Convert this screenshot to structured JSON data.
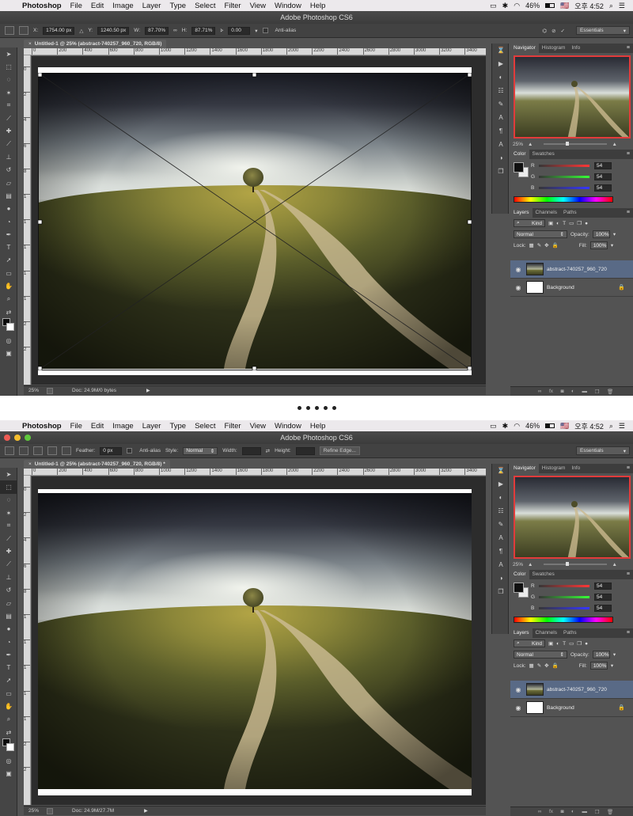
{
  "menubar": {
    "app_name": "Photoshop",
    "menus": [
      "File",
      "Edit",
      "Image",
      "Layer",
      "Type",
      "Select",
      "Filter",
      "View",
      "Window",
      "Help"
    ],
    "battery": "46%",
    "flag": "🇺🇸",
    "clock": "오후 4:52"
  },
  "window": {
    "title": "Adobe Photoshop CS6"
  },
  "document": {
    "tab_title_1": "Untitled-1 @ 25% (abstract-740257_960_720, RGB/8)",
    "tab_title_2": "Untitled-1 @ 25% (abstract-740257_960_720, RGB/8) *",
    "zoom": "25%",
    "doc_info_1": "Doc: 24.9M/0 bytes",
    "doc_info_2": "Doc: 24.9M/27.7M"
  },
  "ruler": {
    "h_ticks": [
      "0",
      "200",
      "400",
      "600",
      "800",
      "1000",
      "1200",
      "1400",
      "1600",
      "1800",
      "2000",
      "2200",
      "2400",
      "2600",
      "2800",
      "3000",
      "3200",
      "3400"
    ],
    "v_ticks": [
      "0",
      "2",
      "4",
      "6",
      "8",
      "1",
      "1",
      "1",
      "1",
      "1",
      "2",
      "2"
    ]
  },
  "options_transform": {
    "x_label": "X:",
    "x_value": "1754.00 px",
    "y_label": "Y:",
    "y_value": "1240.50 px",
    "w_label": "W:",
    "w_value": "87.70%",
    "h_label": "H:",
    "h_value": "87.71%",
    "angle_value": "0.00",
    "antialias": "Anti-alias",
    "workspace": "Essentials"
  },
  "options_marquee": {
    "feather_label": "Feather:",
    "feather_value": "0 px",
    "antialias": "Anti-alias",
    "style_label": "Style:",
    "style_value": "Normal",
    "width_label": "Width:",
    "height_label": "Height:",
    "refine_edge": "Refine Edge...",
    "workspace": "Essentials"
  },
  "navigator": {
    "tabs": [
      "Navigator",
      "Histogram",
      "Info"
    ],
    "zoom": "25%"
  },
  "color_panel": {
    "tabs": [
      "Color",
      "Swatches"
    ],
    "r_label": "R",
    "r_value": "54",
    "g_label": "G",
    "g_value": "54",
    "b_label": "B",
    "b_value": "54"
  },
  "layers_panel": {
    "tabs": [
      "Layers",
      "Channels",
      "Paths"
    ],
    "filter": "Kind",
    "blend_mode": "Normal",
    "opacity_label": "Opacity:",
    "opacity_value": "100%",
    "lock_label": "Lock:",
    "fill_label": "Fill:",
    "fill_value": "100%",
    "layers": [
      "abstract-740257_960_720",
      "Background"
    ]
  },
  "colors": {
    "panel_bg": "#535353",
    "selected_layer": "#596a86",
    "navigator_frame": "#e23b3b"
  }
}
